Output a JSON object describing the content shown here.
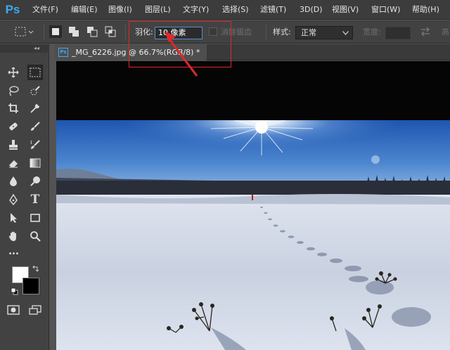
{
  "app": {
    "logo": "Ps"
  },
  "menu": [
    {
      "label": "文件(F)"
    },
    {
      "label": "编辑(E)"
    },
    {
      "label": "图像(I)"
    },
    {
      "label": "图层(L)"
    },
    {
      "label": "文字(Y)"
    },
    {
      "label": "选择(S)"
    },
    {
      "label": "滤镜(T)"
    },
    {
      "label": "3D(D)"
    },
    {
      "label": "视图(V)"
    },
    {
      "label": "窗口(W)"
    },
    {
      "label": "帮助(H)"
    }
  ],
  "options": {
    "feather_label": "羽化:",
    "feather_value": "10 像素",
    "antialias_label": "消除锯齿",
    "style_label": "样式:",
    "style_value": "正常",
    "width_label": "宽度:",
    "height_label_partial": "高"
  },
  "document": {
    "tab_icon": "Ps",
    "tab_title": "_MG_6226.jpg @ 66.7%(RGB/8) *"
  },
  "toolbox": {
    "collapse_glyph": "◂◂",
    "tools": [
      {
        "icon": "move-icon"
      },
      {
        "icon": "rect-marquee-icon"
      },
      {
        "icon": "lasso-icon"
      },
      {
        "icon": "quick-select-icon"
      },
      {
        "icon": "crop-icon"
      },
      {
        "icon": "eyedropper-icon"
      },
      {
        "icon": "healing-brush-icon"
      },
      {
        "icon": "brush-icon"
      },
      {
        "icon": "clone-stamp-icon"
      },
      {
        "icon": "history-brush-icon"
      },
      {
        "icon": "eraser-icon"
      },
      {
        "icon": "gradient-icon"
      },
      {
        "icon": "blur-icon"
      },
      {
        "icon": "dodge-icon"
      },
      {
        "icon": "pen-icon"
      },
      {
        "icon": "type-icon"
      },
      {
        "icon": "path-select-icon"
      },
      {
        "icon": "rectangle-shape-icon"
      },
      {
        "icon": "hand-icon"
      },
      {
        "icon": "zoom-icon"
      },
      {
        "icon": "more-tools-icon"
      },
      {
        "icon": "quick-mask-icon"
      },
      {
        "icon": "screen-mode-icon"
      }
    ],
    "type_glyph": "T",
    "more_glyph": "•••"
  },
  "colors": {
    "foreground": "#ffffff",
    "background": "#000000",
    "annotation": "#e0282b",
    "accent": "#3fa9f5"
  }
}
